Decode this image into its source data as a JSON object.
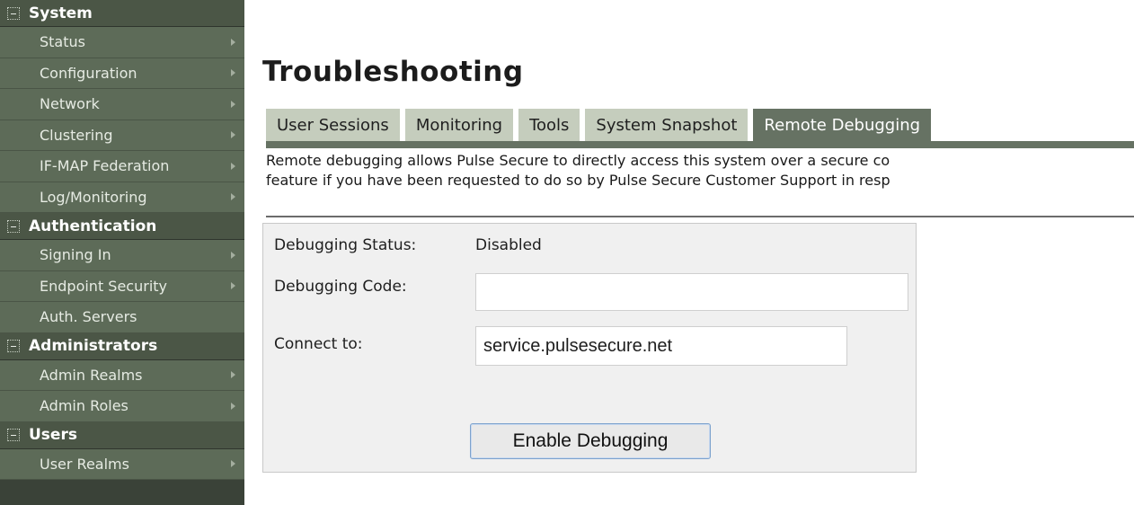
{
  "sidebar": {
    "sections": [
      {
        "title": "System",
        "items": [
          {
            "label": "Status",
            "arrow": true
          },
          {
            "label": "Configuration",
            "arrow": true
          },
          {
            "label": "Network",
            "arrow": true
          },
          {
            "label": "Clustering",
            "arrow": true
          },
          {
            "label": "IF-MAP Federation",
            "arrow": true
          },
          {
            "label": "Log/Monitoring",
            "arrow": true
          }
        ]
      },
      {
        "title": "Authentication",
        "items": [
          {
            "label": "Signing In",
            "arrow": true
          },
          {
            "label": "Endpoint Security",
            "arrow": true
          },
          {
            "label": "Auth. Servers",
            "arrow": false
          }
        ]
      },
      {
        "title": "Administrators",
        "items": [
          {
            "label": "Admin Realms",
            "arrow": true
          },
          {
            "label": "Admin Roles",
            "arrow": true
          }
        ]
      },
      {
        "title": "Users",
        "items": [
          {
            "label": "User Realms",
            "arrow": true
          }
        ]
      }
    ]
  },
  "main": {
    "title": "Troubleshooting",
    "tabs": [
      {
        "label": "User Sessions",
        "active": false
      },
      {
        "label": "Monitoring",
        "active": false
      },
      {
        "label": "Tools",
        "active": false
      },
      {
        "label": "System Snapshot",
        "active": false
      },
      {
        "label": "Remote Debugging",
        "active": true
      }
    ],
    "description_line1": "Remote debugging allows Pulse Secure to directly access this system over a secure co",
    "description_line2": "feature if you have been requested to do so by Pulse Secure Customer Support in resp",
    "form": {
      "status_label": "Debugging Status:",
      "status_value": "Disabled",
      "code_label": "Debugging Code:",
      "code_value": "",
      "connect_label": "Connect to:",
      "connect_value": "service.pulsesecure.net",
      "enable_button": "Enable Debugging"
    }
  },
  "colors": {
    "sidebar_item_bg": "#5d6b58",
    "sidebar_header_bg": "#4b5646",
    "tab_bg": "#c5cdbd",
    "tab_active_bg": "#667263",
    "panel_bg": "#f0f0f0"
  }
}
